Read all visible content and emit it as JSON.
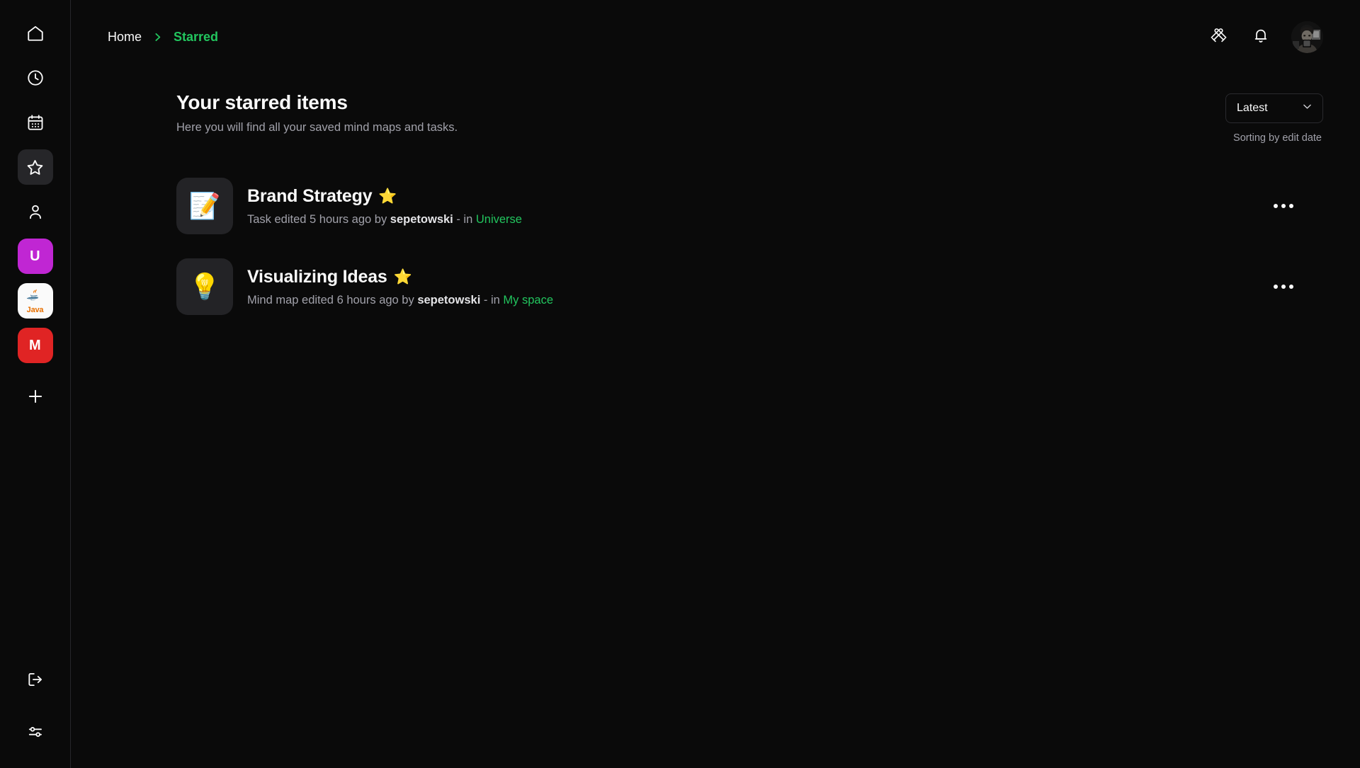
{
  "sidebar": {
    "nav_items": [
      {
        "name": "home",
        "icon": "home-icon",
        "active": false
      },
      {
        "name": "recent",
        "icon": "clock-icon",
        "active": false
      },
      {
        "name": "calendar",
        "icon": "calendar-icon",
        "active": false
      },
      {
        "name": "starred",
        "icon": "star-icon",
        "active": true
      },
      {
        "name": "profile",
        "icon": "user-icon",
        "active": false
      }
    ],
    "workspaces": [
      {
        "label": "U",
        "color": "#C026D3",
        "name": "workspace-u"
      },
      {
        "label": "Java",
        "color": "#FAFAFA",
        "name": "workspace-java"
      },
      {
        "label": "M",
        "color": "#E02424",
        "name": "workspace-m"
      }
    ],
    "add_label": "+",
    "bottom_items": [
      {
        "name": "logout",
        "icon": "logout-icon"
      },
      {
        "name": "settings",
        "icon": "sliders-icon"
      }
    ]
  },
  "topbar": {
    "breadcrumb": {
      "home": "Home",
      "separator": "chevron-right-icon",
      "current": "Starred"
    },
    "actions": [
      {
        "name": "design-tools",
        "icon": "crossed-pens-icon"
      },
      {
        "name": "notifications",
        "icon": "bell-icon"
      }
    ],
    "avatar_name": "user-avatar"
  },
  "page": {
    "title": "Your starred items",
    "subtitle": "Here you will find all your saved mind maps and tasks.",
    "sort": {
      "value": "Latest",
      "chevron": "chevron-down-icon",
      "note": "Sorting by edit date"
    }
  },
  "items": [
    {
      "icon": "memo-icon",
      "emoji": "📝",
      "title": "Brand Strategy",
      "star": "⭐",
      "meta_prefix": "Task edited 5 hours ago by ",
      "author": "sepetowski",
      "meta_middle": " - in ",
      "space": "Universe"
    },
    {
      "icon": "lightbulb-icon",
      "emoji": "💡",
      "title": "Visualizing Ideas",
      "star": "⭐",
      "meta_prefix": "Mind map edited 6 hours ago by ",
      "author": "sepetowski",
      "meta_middle": " - in ",
      "space": "My space"
    }
  ],
  "colors": {
    "accent_green": "#22C55E",
    "background": "#0A0A0A",
    "tile": "#232326",
    "muted_text": "#A1A1AA"
  }
}
